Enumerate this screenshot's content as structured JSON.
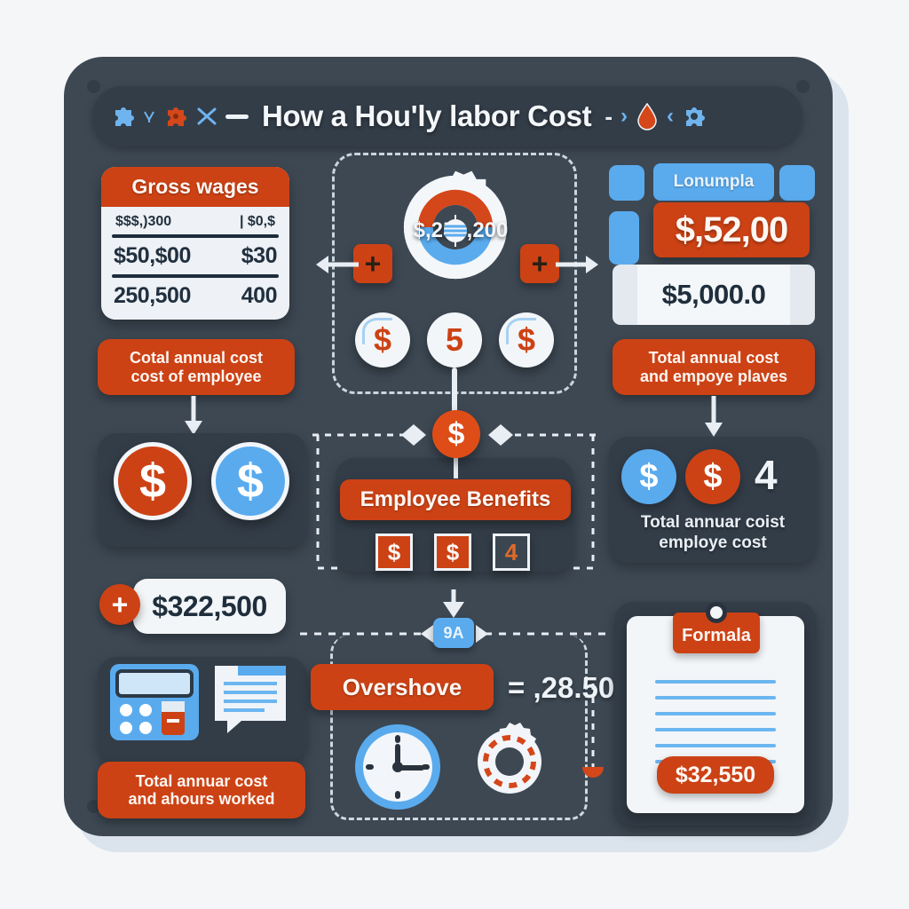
{
  "header": {
    "title": "How a Hou'ly labor Cost",
    "left_icons": [
      "puzzle-piece-blue-icon",
      "small-blue-glyph-icon",
      "puzzle-piece-orange-icon",
      "x-mark-icon",
      "dash-icon"
    ],
    "right_icons": [
      "chevron-right-icon",
      "droplet-icon",
      "chevron-left-icon",
      "gear-puzzle-icon"
    ],
    "separator": "-"
  },
  "gross_wages": {
    "heading": "Gross wages",
    "table": {
      "header_row": [
        "$$$,)300",
        "| $0,$"
      ],
      "rows": [
        [
          "$50,$00",
          "$30"
        ],
        [
          "250,500",
          "400"
        ]
      ]
    },
    "caption_line1": "Cotal annual cost",
    "caption_line2": "cost of employee"
  },
  "center": {
    "gear_value": "$,25,   ,200",
    "plus_left": "+",
    "plus_right": "+",
    "coins": [
      "$",
      "5",
      "$"
    ]
  },
  "top_right": {
    "tab_label": "Lonumpla",
    "orange_value": "$,52,00",
    "white_value": "$5,000.0",
    "caption_line1": "Total annual cost",
    "caption_line2": "and empoye plaves"
  },
  "mid_left": {
    "coin_orange": "$",
    "coin_blue": "$"
  },
  "benefits": {
    "circle_symbol": "$",
    "label": "Employee Benefits",
    "squares": [
      "$",
      "$",
      "4"
    ]
  },
  "mid_right": {
    "coin_blue": "$",
    "coin_orange": "$",
    "number": "4",
    "caption_line1": "Total annuar coist",
    "caption_line2": "employe cost"
  },
  "bottom_left": {
    "plus": "+",
    "value": "$322,500",
    "icons": [
      "calculator-icon",
      "document-icon"
    ],
    "caption_line1": "Total annuar cost",
    "caption_line2": "and ahours worked"
  },
  "bottom_center": {
    "badge": "9A",
    "label": "Overshove",
    "equals_value": "= ,28.50",
    "icons": [
      "clock-icon",
      "gear-dashed-icon"
    ]
  },
  "clipboard": {
    "clip_label": "Formala",
    "line_count": 6,
    "value": "$32,550"
  },
  "colors": {
    "page_bg": "#f5f6f8",
    "board": "#3d4853",
    "panel": "#333d48",
    "orange": "#cc4215",
    "blue": "#5aabee",
    "white": "#f3f6f9",
    "text_light": "#eef3f8"
  }
}
